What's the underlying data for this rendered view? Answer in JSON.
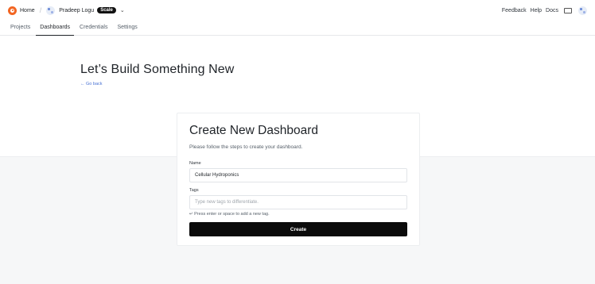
{
  "topbar": {
    "home_label": "Home",
    "separator": "/",
    "user_name": "Pradeep Logu",
    "plan_badge": "Scale",
    "chevron": "⌄",
    "right_links": [
      "Feedback",
      "Help",
      "Docs"
    ]
  },
  "tabs": [
    {
      "label": "Projects",
      "active": false
    },
    {
      "label": "Dashboards",
      "active": true
    },
    {
      "label": "Credentials",
      "active": false
    },
    {
      "label": "Settings",
      "active": false
    }
  ],
  "hero": {
    "title": "Let’s Build Something New",
    "go_back": "← Go back"
  },
  "card": {
    "title": "Create New Dashboard",
    "subtitle": "Please follow the steps to create your dashboard.",
    "name_label": "Name",
    "name_value": "Cellular Hydroponics",
    "tags_label": "Tags",
    "tags_placeholder": "Type new tags to differentiate.",
    "tags_hint": "↵ Press enter or space to add a new tag.",
    "create_button": "Create"
  },
  "colors": {
    "accent_orange": "#f26522",
    "link_blue": "#4a72d4",
    "button_black": "#0b0b0b",
    "lower_bg": "#f6f7f8"
  },
  "icons": [
    "logo-icon",
    "user-avatar-icon",
    "chevron-down-icon",
    "keyboard-icon",
    "profile-avatar-icon",
    "enter-key-icon"
  ]
}
